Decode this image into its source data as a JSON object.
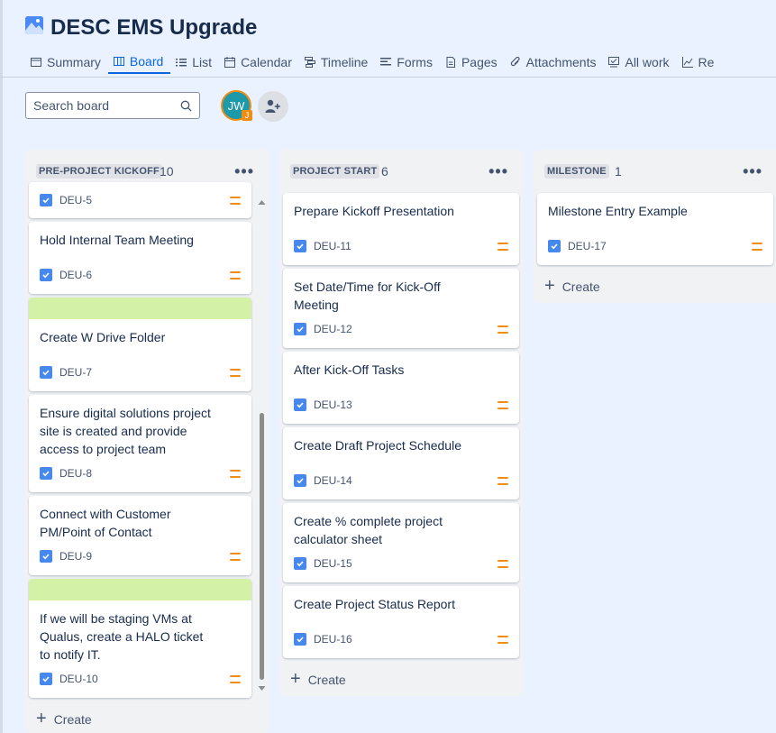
{
  "project": {
    "title": "DESC EMS Upgrade"
  },
  "tabs": [
    {
      "label": "Summary",
      "icon": "summary-icon"
    },
    {
      "label": "Board",
      "icon": "board-icon",
      "active": true
    },
    {
      "label": "List",
      "icon": "list-icon"
    },
    {
      "label": "Calendar",
      "icon": "calendar-icon"
    },
    {
      "label": "Timeline",
      "icon": "timeline-icon"
    },
    {
      "label": "Forms",
      "icon": "forms-icon"
    },
    {
      "label": "Pages",
      "icon": "pages-icon"
    },
    {
      "label": "Attachments",
      "icon": "attachment-icon"
    },
    {
      "label": "All work",
      "icon": "all-work-icon"
    },
    {
      "label": "Re",
      "icon": "reports-icon"
    }
  ],
  "search": {
    "placeholder": "Search board"
  },
  "avatar": {
    "initials": "JW",
    "badge": "J"
  },
  "columns": [
    {
      "name": "PRE-PROJECT KICKOFF",
      "count": "10",
      "cards": [
        {
          "title": "",
          "key": "DEU-5"
        },
        {
          "title": "Hold Internal Team Meeting",
          "key": "DEU-6"
        },
        {
          "title": "Create W Drive Folder",
          "key": "DEU-7",
          "cover": "#d3f1a7"
        },
        {
          "title": "Ensure digital solutions project site is created and provide access to project team",
          "key": "DEU-8"
        },
        {
          "title": "Connect with Customer PM/Point of Contact",
          "key": "DEU-9"
        },
        {
          "title": "If we will be staging VMs at Qualus, create a HALO ticket to notify IT.",
          "key": "DEU-10",
          "cover": "#d3f1a7"
        }
      ],
      "create_label": "Create"
    },
    {
      "name": "PROJECT START",
      "count": "6",
      "cards": [
        {
          "title": "Prepare Kickoff Presentation",
          "key": "DEU-11"
        },
        {
          "title": "Set Date/Time for Kick-Off Meeting",
          "key": "DEU-12"
        },
        {
          "title": "After Kick-Off Tasks",
          "key": "DEU-13"
        },
        {
          "title": "Create Draft Project Schedule",
          "key": "DEU-14"
        },
        {
          "title": "Create % complete project calculator sheet",
          "key": "DEU-15"
        },
        {
          "title": "Create Project Status Report",
          "key": "DEU-16"
        }
      ],
      "create_label": "Create"
    },
    {
      "name": "MILESTONE",
      "count": "1",
      "cards": [
        {
          "title": "Milestone Entry Example",
          "key": "DEU-17"
        }
      ],
      "create_label": "Create"
    }
  ],
  "colors": {
    "accent": "#0c66e4",
    "priority_medium": "#f18d13",
    "card_cover": "#d3f1a7",
    "checkbox": "#4688ec"
  }
}
